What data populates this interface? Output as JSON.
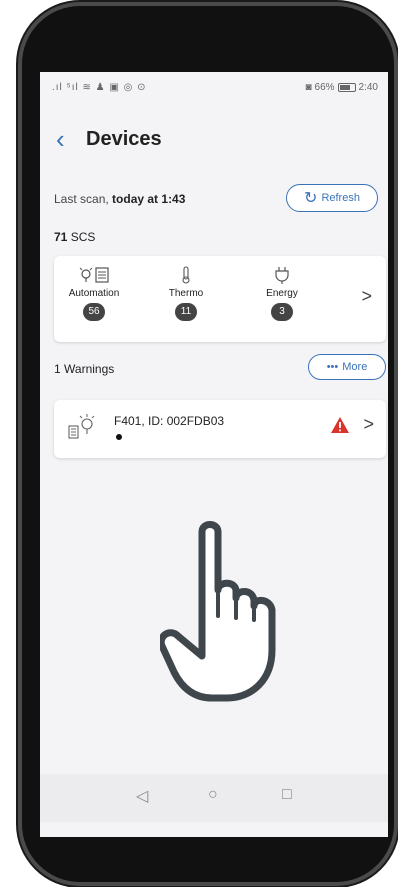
{
  "status_bar": {
    "left_icons": ".ıl ⁵ıl ≋ ♟ ▣ ◎ ⊙",
    "battery_text": "66%",
    "time": "2:40"
  },
  "header": {
    "title": "Devices",
    "back_icon": "chevron-left-icon"
  },
  "scan": {
    "prefix": "Last scan,",
    "time": "today at 1:43",
    "refresh_label": "Refresh"
  },
  "summary": {
    "count": "71",
    "unit": "SCS"
  },
  "categories": [
    {
      "label": "Automation",
      "count": "56",
      "icon": "bulb-and-panel-icon"
    },
    {
      "label": "Thermo",
      "count": "11",
      "icon": "thermometer-icon"
    },
    {
      "label": "Energy",
      "count": "3",
      "icon": "plug-icon"
    }
  ],
  "warnings": {
    "count": "1",
    "label": "Warnings",
    "more_label": "More"
  },
  "device": {
    "name": "F401, ID: 002FDB03"
  },
  "colors": {
    "accent": "#3a73b8",
    "warning": "#d9352b",
    "badge": "#444444"
  }
}
